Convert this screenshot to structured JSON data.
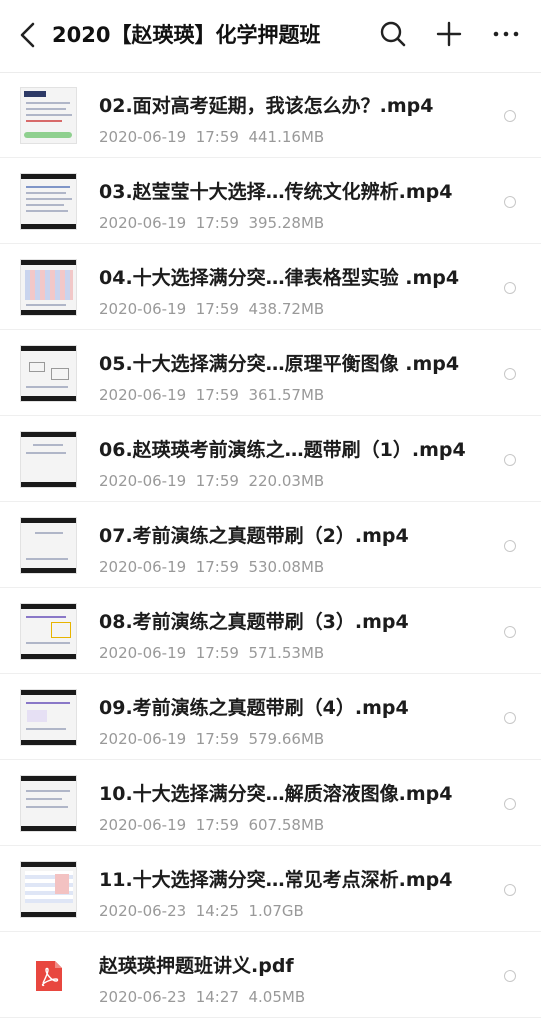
{
  "header": {
    "title": "2020【赵瑛瑛】化学押题班",
    "icons": [
      "back-icon",
      "search-icon",
      "plus-icon",
      "more-icon"
    ]
  },
  "files": [
    {
      "name": "02.面对高考延期，我该怎么办？.mp4",
      "meta": "2020-06-19  17:59  441.16MB",
      "type": "video"
    },
    {
      "name": "03.赵莹莹十大选择…传统文化辨析.mp4",
      "meta": "2020-06-19  17:59  395.28MB",
      "type": "video"
    },
    {
      "name": "04.十大选择满分突…律表格型实验 .mp4",
      "meta": "2020-06-19  17:59  438.72MB",
      "type": "video"
    },
    {
      "name": "05.十大选择满分突…原理平衡图像 .mp4",
      "meta": "2020-06-19  17:59  361.57MB",
      "type": "video"
    },
    {
      "name": "06.赵瑛瑛考前演练之…题带刷（1）.mp4",
      "meta": "2020-06-19  17:59  220.03MB",
      "type": "video"
    },
    {
      "name": "07.考前演练之真题带刷（2）.mp4",
      "meta": "2020-06-19  17:59  530.08MB",
      "type": "video"
    },
    {
      "name": "08.考前演练之真题带刷（3）.mp4",
      "meta": "2020-06-19  17:59  571.53MB",
      "type": "video"
    },
    {
      "name": "09.考前演练之真题带刷（4）.mp4",
      "meta": "2020-06-19  17:59  579.66MB",
      "type": "video"
    },
    {
      "name": "10.十大选择满分突…解质溶液图像.mp4",
      "meta": "2020-06-19  17:59  607.58MB",
      "type": "video"
    },
    {
      "name": "11.十大选择满分突…常见考点深析.mp4",
      "meta": "2020-06-23  14:25  1.07GB",
      "type": "video"
    },
    {
      "name": "赵瑛瑛押题班讲义.pdf",
      "meta": "2020-06-23  14:27  4.05MB",
      "type": "pdf"
    }
  ],
  "colors": {
    "pdf": "#e8473f",
    "text": "#1c1c1c",
    "meta": "#999999"
  }
}
